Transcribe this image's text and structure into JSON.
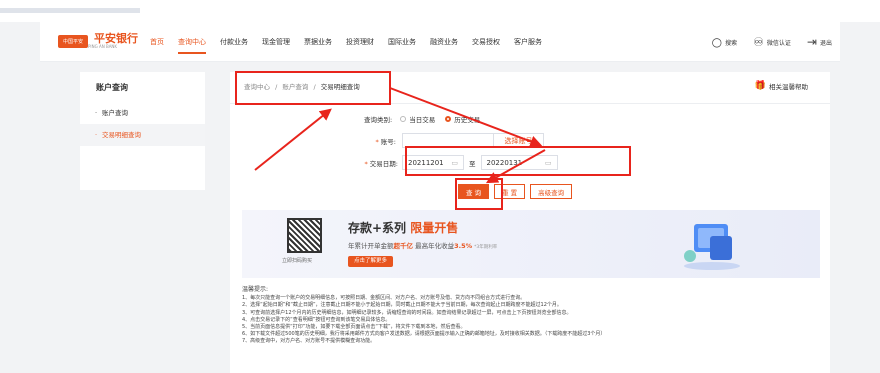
{
  "bank": {
    "logo_mark": "中国平安",
    "name": "平安银行",
    "sub": "PING AN BANK"
  },
  "nav": {
    "items": [
      "首页",
      "查询中心",
      "付款业务",
      "现金管理",
      "票据业务",
      "投资理财",
      "国际业务",
      "融资业务",
      "交易授权",
      "客户服务"
    ],
    "search": "搜索",
    "wechat": "微信认证",
    "logout": "退出"
  },
  "sidebar": {
    "title": "账户查询",
    "items": [
      "账户查询",
      "交易明细查询"
    ]
  },
  "breadcrumb": {
    "root": "查询中心",
    "mid": "账户查询",
    "current": "交易明细查询",
    "sep": "/"
  },
  "help": "相关温馨帮助",
  "form": {
    "type_label": "查询类别:",
    "type_options": [
      "当日交易",
      "历史交易"
    ],
    "type_selected": 1,
    "account_label": "账号:",
    "account_value": "",
    "select_account": "选择账号",
    "date_label": "交易日期:",
    "date_from": "20211201",
    "date_to": "20220131",
    "date_sep": "至",
    "query_btn": "查 询",
    "reset_btn": "重 置",
    "advanced_btn": "高级查询"
  },
  "banner": {
    "title": "存款+系列",
    "title_hl": "限量开售",
    "sub_pre": "年累计开单金额",
    "sub_hl1": "超千亿",
    "sub_mid": " 最高年化收益",
    "sub_hl2": "3.5%",
    "sub_note": "*3年期利率",
    "cta": "点击了解更多",
    "qr_caption": "立即扫码购买"
  },
  "tips": {
    "title": "温馨提示:",
    "lines": [
      "1、每次只能查询一个账户的交易明细信息，可按照日期、金额区间、对方户名、对方账号及借、贷方向不同组合方式进行查询。",
      "2、选择“起始日期”和“截止日期”，注意截止日期不能小于起始日期，同时截止日期不能大于当前日期，每次查询起止日期跨度不能超过12个月。",
      "3、可查询前选择户12个月内的历史明细信息，如明细记录较多，请缩短查询的时间段。如查询结果记录超过一屏，可点击上下页按钮浏览全部信息。",
      "4、点击交易记录下的“查看明细”按钮可查询到该笔交易具体信息。",
      "5、当前页面信息提供“打印”功能，如要下载全部页面请点击“下载”，将文件下载到本地，然后查看。",
      "6、如下载文件超过500笔的历史明细，我行将采用邮件方式向客户发送数据，请根据页面提示输入正确的邮箱地址，及时接收相关数据。（下载跨度不能超过3个月）",
      "7、高级查询中，对方户名、对方账号不提供模糊查询功能。"
    ]
  },
  "colors": {
    "accent": "#e8551f",
    "annotation": "#e8241c"
  }
}
